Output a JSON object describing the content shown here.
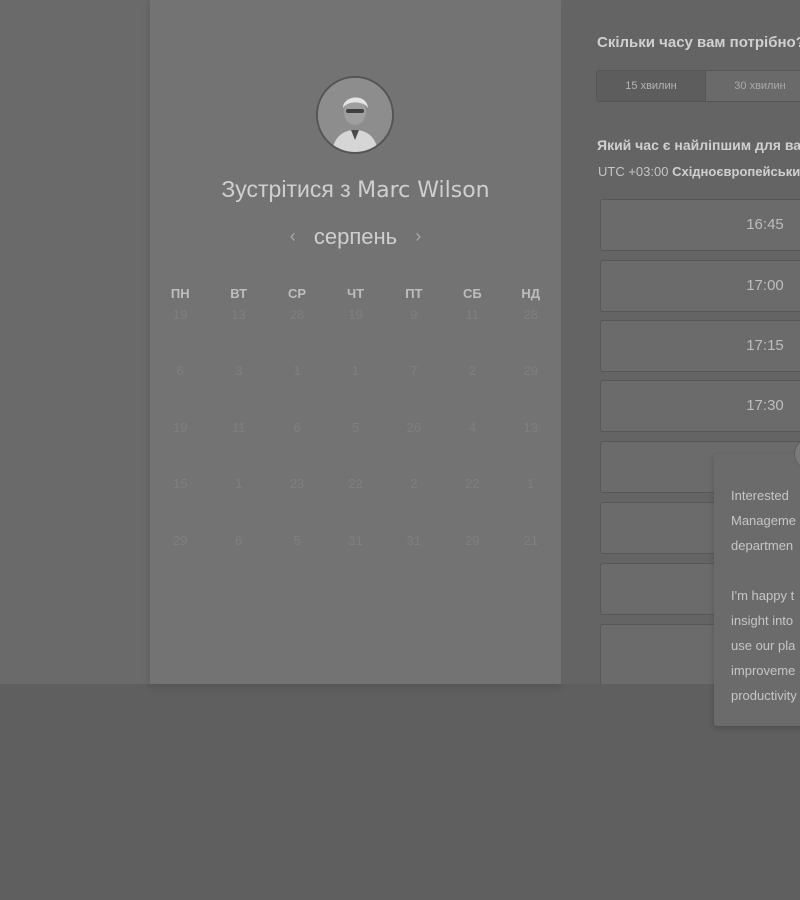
{
  "meeting": {
    "title_prefix": "Зустрітися з",
    "host_name": "Marc Wilson"
  },
  "calendar": {
    "month": "серпень",
    "prev_icon": "chevron-left-icon",
    "next_icon": "chevron-right-icon",
    "weekdays": [
      "ПН",
      "ВТ",
      "СР",
      "ЧТ",
      "ПТ",
      "СБ",
      "НД"
    ],
    "weeks": [
      [
        "19",
        "13",
        "28",
        "19",
        "9",
        "11",
        "28"
      ],
      [
        "6",
        "3",
        "1",
        "1",
        "7",
        "2",
        "29"
      ],
      [
        "19",
        "11",
        "6",
        "5",
        "26",
        "4",
        "13"
      ],
      [
        "15",
        "1",
        "23",
        "22",
        "2",
        "22",
        "1"
      ],
      [
        "29",
        "6",
        "5",
        "31",
        "31",
        "29",
        "21"
      ]
    ]
  },
  "booking": {
    "duration_question": "Скільки часу вам потрібно?",
    "durations": [
      "15 хвилин",
      "30 хвилин"
    ],
    "time_question": "Який час є найліпшим для вас?",
    "timezone_offset": "UTC +03:00",
    "timezone_name": "Східноєвропейський час",
    "slots": [
      "16:45",
      "17:00",
      "17:15",
      "17:30",
      "",
      "",
      "",
      ""
    ]
  },
  "chat_popup": {
    "lines": [
      "Interested",
      "Manageme",
      "departmen",
      "",
      "I'm happy t",
      "insight into",
      "use our pla",
      "improveme",
      "productivity"
    ]
  }
}
